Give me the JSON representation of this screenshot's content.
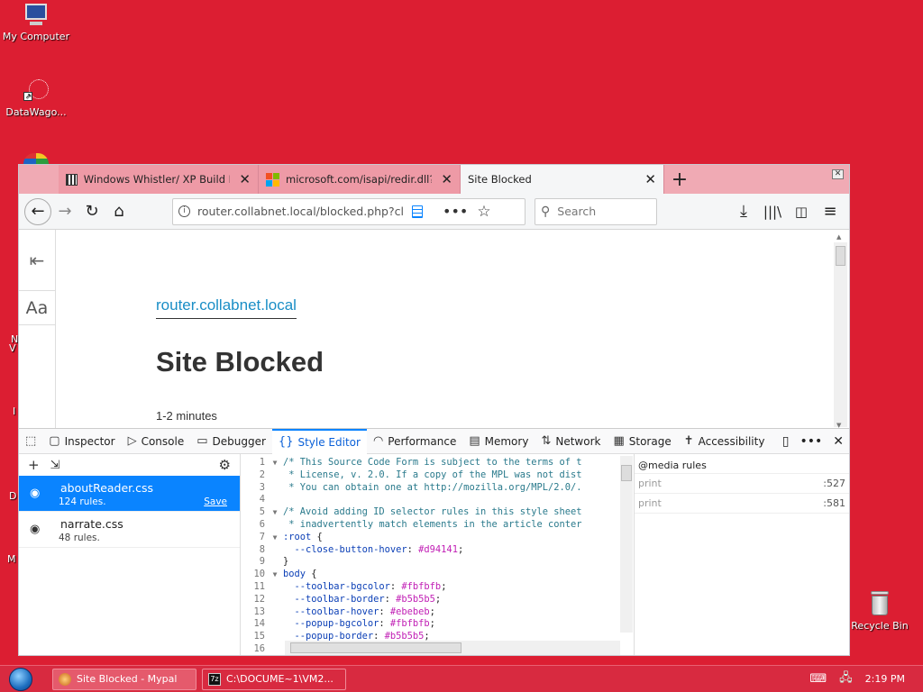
{
  "desktop": {
    "icons": [
      {
        "label": "My Computer"
      },
      {
        "label": "DataWago..."
      },
      {
        "label": "Recycle Bin"
      }
    ]
  },
  "browser": {
    "tabs": [
      {
        "title": "Windows Whistler/ XP Build List"
      },
      {
        "title": "microsoft.com/isapi/redir.dll?pr"
      },
      {
        "title": "Site Blocked"
      }
    ],
    "new_tab": "+",
    "url": "router.collabnet.local/blocked.php?clien",
    "search_placeholder": "Search"
  },
  "reader": {
    "domain": "router.collabnet.local",
    "title": "Site Blocked",
    "reading_time": "1-2 minutes"
  },
  "devtools": {
    "tabs": [
      {
        "label": "Inspector"
      },
      {
        "label": "Console"
      },
      {
        "label": "Debugger"
      },
      {
        "label": "Style Editor"
      },
      {
        "label": "Performance"
      },
      {
        "label": "Memory"
      },
      {
        "label": "Network"
      },
      {
        "label": "Storage"
      },
      {
        "label": "Accessibility"
      }
    ],
    "stylesheets": [
      {
        "name": "aboutReader.css",
        "rules": "124 rules.",
        "save": "Save"
      },
      {
        "name": "narrate.css",
        "rules": "48 rules."
      }
    ],
    "code_lines": [
      {
        "n": "1",
        "text": "/* This Source Code Form is subject to the terms of t"
      },
      {
        "n": "2",
        "text": " * License, v. 2.0. If a copy of the MPL was not dist"
      },
      {
        "n": "3",
        "text": " * You can obtain one at http://mozilla.org/MPL/2.0/."
      },
      {
        "n": "4",
        "text": ""
      },
      {
        "n": "5",
        "text": "/* Avoid adding ID selector rules in this style sheet"
      },
      {
        "n": "6",
        "text": " * inadvertently match elements in the article conter"
      },
      {
        "n": "7",
        "text": ":root {"
      },
      {
        "n": "8",
        "text": "  --close-button-hover: #d94141;"
      },
      {
        "n": "9",
        "text": "}"
      },
      {
        "n": "10",
        "text": "body {"
      },
      {
        "n": "11",
        "text": "  --toolbar-bgcolor: #fbfbfb;"
      },
      {
        "n": "12",
        "text": "  --toolbar-border: #b5b5b5;"
      },
      {
        "n": "13",
        "text": "  --toolbar-hover: #ebebeb;"
      },
      {
        "n": "14",
        "text": "  --popup-bgcolor: #fbfbfb;"
      },
      {
        "n": "15",
        "text": "  --popup-border: #b5b5b5;"
      },
      {
        "n": "16",
        "text": ""
      }
    ],
    "media": {
      "heading": "@media rules",
      "rows": [
        {
          "label": "print",
          "line": ":527"
        },
        {
          "label": "print",
          "line": ":581"
        }
      ]
    }
  },
  "taskbar": {
    "items": [
      {
        "label": "Site Blocked - Mypal"
      },
      {
        "label": "C:\\DOCUME~1\\VM2..."
      }
    ],
    "clock": "2:19 PM"
  },
  "colors": {
    "desktop": "#dc1e32",
    "accent": "#0a84ff",
    "link": "#1a8ec6"
  }
}
